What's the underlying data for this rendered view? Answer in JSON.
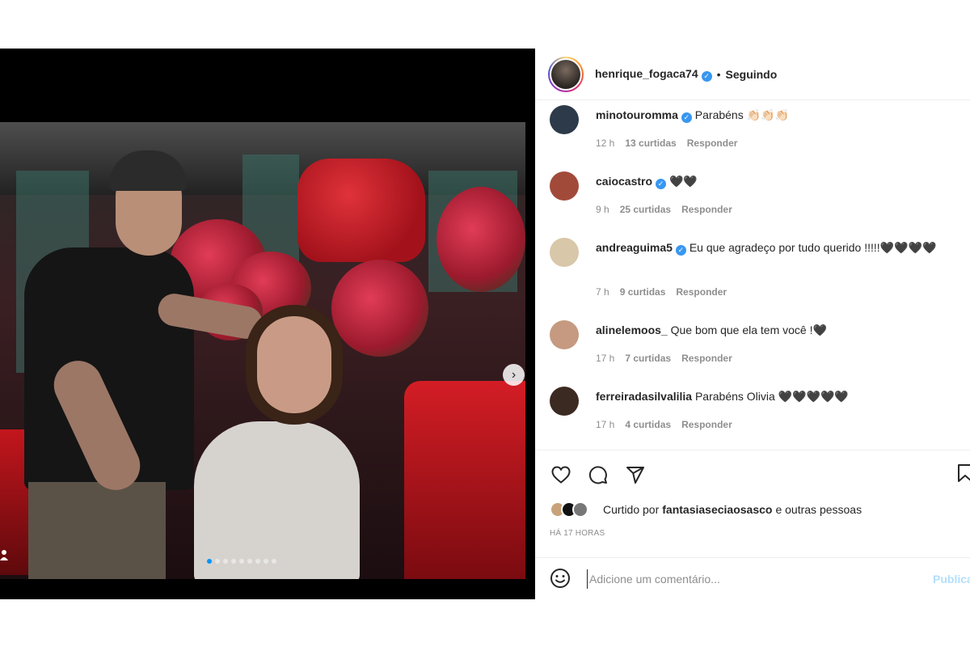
{
  "post": {
    "username": "henrique_fogaca74",
    "separator": "•",
    "follow_status": "Seguindo",
    "carousel_dots": 9
  },
  "comments": [
    {
      "user": "minotouromma",
      "verified": true,
      "text": "Parabéns 👏🏻👏🏻👏🏻",
      "time": "12 h",
      "likes": "13 curtidas",
      "reply": "Responder",
      "avatar_color": "#2c3a4a"
    },
    {
      "user": "caiocastro",
      "verified": true,
      "text": "🖤🖤",
      "time": "9 h",
      "likes": "25 curtidas",
      "reply": "Responder",
      "avatar_color": "#a24a3a"
    },
    {
      "user": "andreaguima5",
      "verified": true,
      "text": "Eu que agradeço por tudo querido !!!!!🖤🖤🖤🖤",
      "time": "7 h",
      "likes": "9 curtidas",
      "reply": "Responder",
      "avatar_color": "#d8c7a8"
    },
    {
      "user": "alinelemoos_",
      "verified": false,
      "text": "Que bom que ela tem você !🖤",
      "time": "17 h",
      "likes": "7 curtidas",
      "reply": "Responder",
      "avatar_color": "#c59a80"
    },
    {
      "user": "ferreiradasilvalilia",
      "verified": false,
      "text": "Parabéns Olivia 🖤🖤🖤🖤🖤",
      "time": "17 h",
      "likes": "4 curtidas",
      "reply": "Responder",
      "avatar_color": "#3b2a22"
    }
  ],
  "likes": {
    "prefix": "Curtido por",
    "user": "fantasiaseciaosasco",
    "suffix": "e outras pessoas"
  },
  "time_ago": "HÁ 17 HORAS",
  "add_comment": {
    "placeholder": "Adicione um comentário...",
    "publish_label": "Publicar"
  },
  "icons": {
    "like": "heart-icon",
    "comment": "comment-icon",
    "share": "share-icon",
    "save": "bookmark-icon",
    "emoji": "emoji-icon",
    "next": "chevron-right-icon"
  },
  "colors": {
    "link_blue": "#0095f6",
    "verified": "#3897f0",
    "muted": "#8e8e8e",
    "text": "#262626"
  }
}
